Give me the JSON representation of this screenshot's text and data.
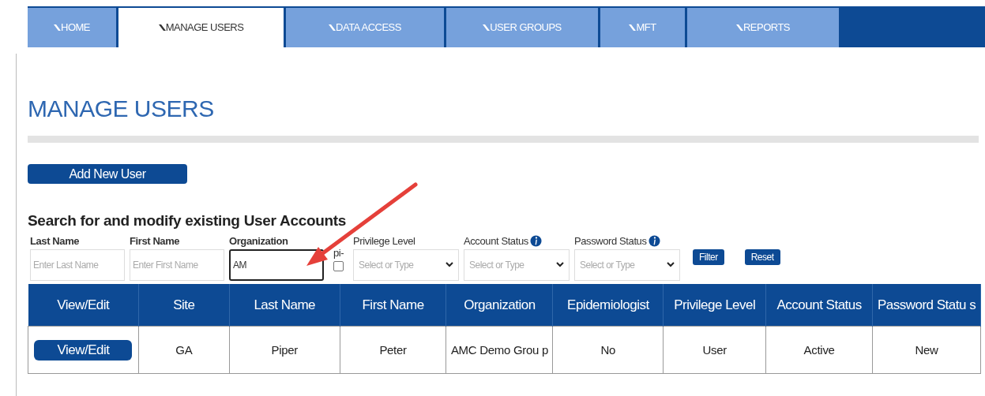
{
  "tabs": [
    {
      "label": "HOME",
      "selected": false
    },
    {
      "label": "MANAGE USERS",
      "selected": true
    },
    {
      "label": "DATA ACCESS",
      "selected": false
    },
    {
      "label": "USER GROUPS",
      "selected": false
    },
    {
      "label": "MFT",
      "selected": false
    },
    {
      "label": "REPORTS",
      "selected": false
    }
  ],
  "page_title": "MANAGE USERS",
  "add_button": "Add New User",
  "search_heading": "Search for and modify existing User Accounts",
  "filters": [
    {
      "kind": "text",
      "label": "Last Name",
      "placeholder": "Enter Last Name"
    },
    {
      "kind": "text",
      "label": "First Name",
      "placeholder": "Enter First Name"
    },
    {
      "kind": "text",
      "label": "Organization",
      "value": "AM",
      "focused": true
    },
    {
      "kind": "checkbox",
      "label": "pi-",
      "checked": false
    },
    {
      "kind": "select",
      "label": "Privilege Level",
      "placeholder": "Select or Type"
    },
    {
      "kind": "select",
      "label": "Account Status",
      "placeholder": "Select or Type",
      "info": true
    },
    {
      "kind": "select",
      "label": "Password Status",
      "placeholder": "Select or Type",
      "info": true
    }
  ],
  "filter_buttons": [
    "Filter",
    "Reset"
  ],
  "table": {
    "columns": [
      "View/Edit",
      "Site",
      "Last Name",
      "First Name",
      "Organization",
      "Epidemiologist",
      "Privilege Level",
      "Account Status",
      "Password Statu s"
    ],
    "rows": [
      {
        "cells": [
          "View/Edit",
          "GA",
          "Piper",
          "Peter",
          "AMC Demo Grou p",
          "No",
          "User",
          "Active",
          "New"
        ]
      }
    ]
  }
}
